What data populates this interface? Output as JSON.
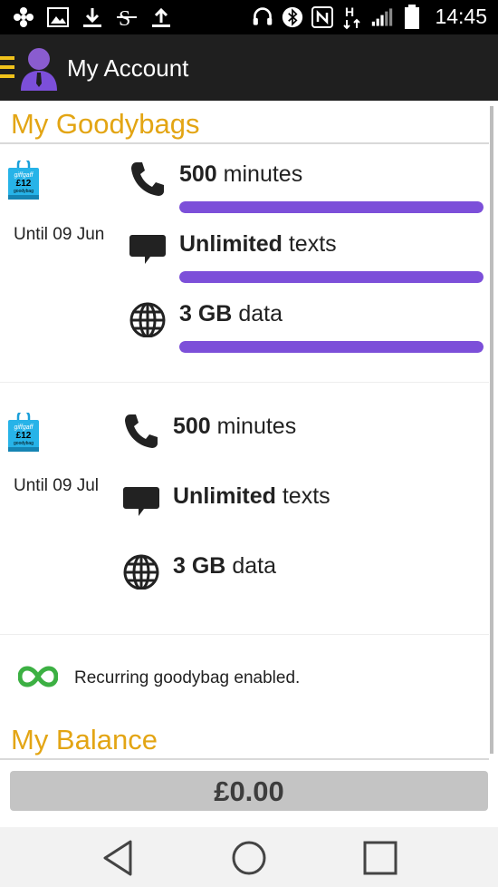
{
  "status_bar": {
    "time": "14:45",
    "icons_left": [
      "fan-icon",
      "image-icon",
      "download-icon",
      "s-icon",
      "upload-icon"
    ],
    "icons_right": [
      "headset-icon",
      "bluetooth-icon",
      "nfc-icon",
      "h-data-icon",
      "signal-icon",
      "battery-icon"
    ]
  },
  "app_bar": {
    "title": "My Account"
  },
  "goodybags": {
    "section_title": "My Goodybags",
    "bag_icon_price": "£12",
    "bag_icon_brand": "giffgaff",
    "bag_icon_sub": "goodybag",
    "bags": [
      {
        "until": "Until 09 Jun",
        "items": [
          {
            "icon": "phone-icon",
            "amount": "500",
            "unit": "minutes",
            "level": 1.0
          },
          {
            "icon": "speech-bubble-icon",
            "amount": "Unlimited",
            "unit": "texts",
            "level": 1.0
          },
          {
            "icon": "globe-icon",
            "amount": "3 GB",
            "unit": "data",
            "level": 1.0
          }
        ]
      },
      {
        "until": "Until 09 Jul",
        "items": [
          {
            "icon": "phone-icon",
            "amount": "500",
            "unit": "minutes"
          },
          {
            "icon": "speech-bubble-icon",
            "amount": "Unlimited",
            "unit": "texts"
          },
          {
            "icon": "globe-icon",
            "amount": "3 GB",
            "unit": "data"
          }
        ]
      }
    ],
    "recurring_text": "Recurring goodybag enabled."
  },
  "balance": {
    "section_title": "My Balance",
    "amount": "£0.00"
  },
  "colors": {
    "accent": "#e3a514",
    "progress": "#7c4fd9",
    "recurring": "#3cb043",
    "appbar": "#1f1f1f"
  }
}
